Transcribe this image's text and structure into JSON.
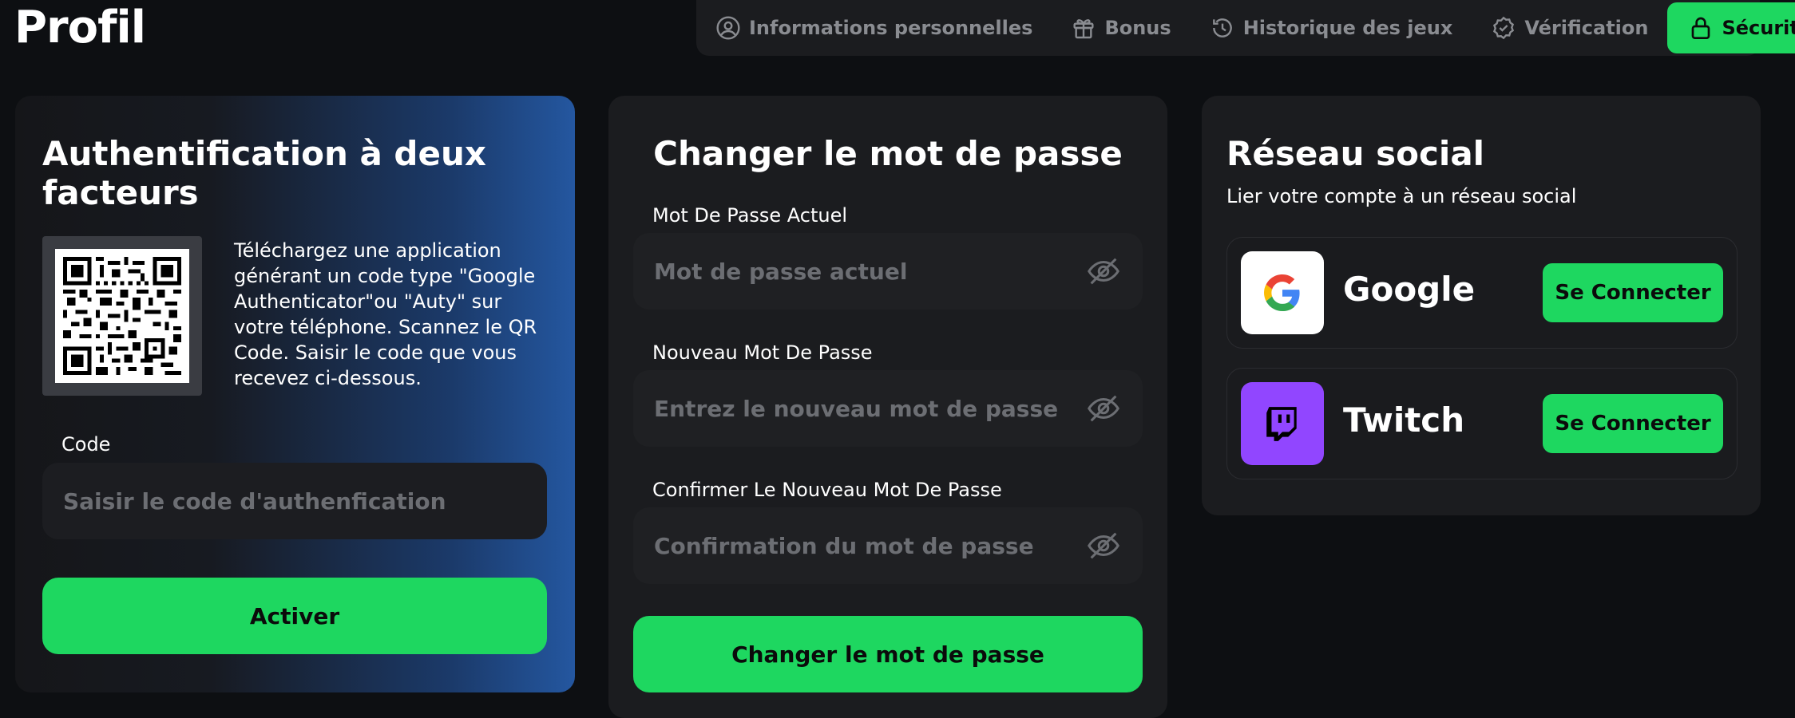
{
  "page": {
    "title": "Profil"
  },
  "tabs": [
    {
      "label": "Informations personnelles",
      "icon": "user-circle-icon",
      "active": false
    },
    {
      "label": "Bonus",
      "icon": "gift-icon",
      "active": false
    },
    {
      "label": "Historique des jeux",
      "icon": "history-icon",
      "active": false
    },
    {
      "label": "Vérification",
      "icon": "badge-check-icon",
      "active": false
    },
    {
      "label": "Sécurité",
      "icon": "lock-icon",
      "active": true
    }
  ],
  "two_factor": {
    "title": "Authentification à deux facteurs",
    "qr_icon": "qr-code-icon",
    "description": "Téléchargez une application générant un code type \"Google Authenticator\"ou \"Auty\" sur votre téléphone. Scannez le QR Code. Saisir le code que vous recevez ci-dessous.",
    "code_label": "Code",
    "code_placeholder": "Saisir le code d'authenfication",
    "code_value": "",
    "activate_label": "Activer"
  },
  "password": {
    "title": "Changer le mot de passe",
    "current_label": "Mot De Passe Actuel",
    "current_placeholder": "Mot de passe actuel",
    "new_label": "Nouveau Mot De Passe",
    "new_placeholder": "Entrez le nouveau mot de passe",
    "confirm_label": "Confirmer Le Nouveau Mot De Passe",
    "confirm_placeholder": "Confirmation du mot de passe",
    "submit_label": "Changer le mot de passe"
  },
  "social": {
    "title": "Réseau social",
    "subtitle": "Lier votre compte à un réseau social",
    "providers": [
      {
        "name": "Google",
        "icon": "google-icon",
        "button": "Se Connecter"
      },
      {
        "name": "Twitch",
        "icon": "twitch-icon",
        "button": "Se Connecter"
      }
    ]
  },
  "colors": {
    "accent": "#1ed760",
    "background": "#0d0f12",
    "card": "#1b1c1f",
    "twitch": "#9146ff",
    "gradient_blue": "#2457a0"
  }
}
